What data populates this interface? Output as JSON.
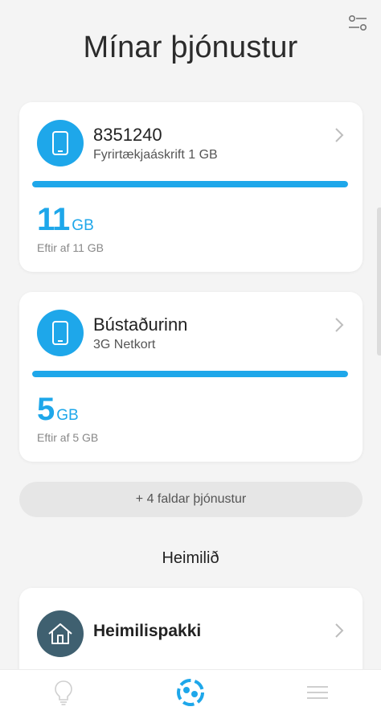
{
  "header": {
    "title": "Mínar þjónustur"
  },
  "services": [
    {
      "number": "8351240",
      "plan": "Fyrirtækjaáskrift 1 GB",
      "remaining_value": "11",
      "remaining_unit": "GB",
      "remaining_text": "Eftir af 11 GB",
      "usage_fraction": 1.0,
      "icon": "phone-icon"
    },
    {
      "number": "Bústaðurinn",
      "plan": "3G Netkort",
      "remaining_value": "5",
      "remaining_unit": "GB",
      "remaining_text": "Eftir af 5 GB",
      "usage_fraction": 1.0,
      "icon": "phone-icon"
    }
  ],
  "hidden_services_label": "+ 4 faldar þjónustur",
  "home": {
    "heading": "Heimilið",
    "package_label": "Heimilispakki",
    "icon": "house-icon"
  },
  "nav": {
    "items": [
      "lightbulb-icon",
      "logo-icon",
      "menu-icon"
    ],
    "active": "logo-icon"
  },
  "colors": {
    "accent": "#1ea7ea",
    "home_icon_bg": "#3f6070",
    "background": "#f4f4f4"
  }
}
